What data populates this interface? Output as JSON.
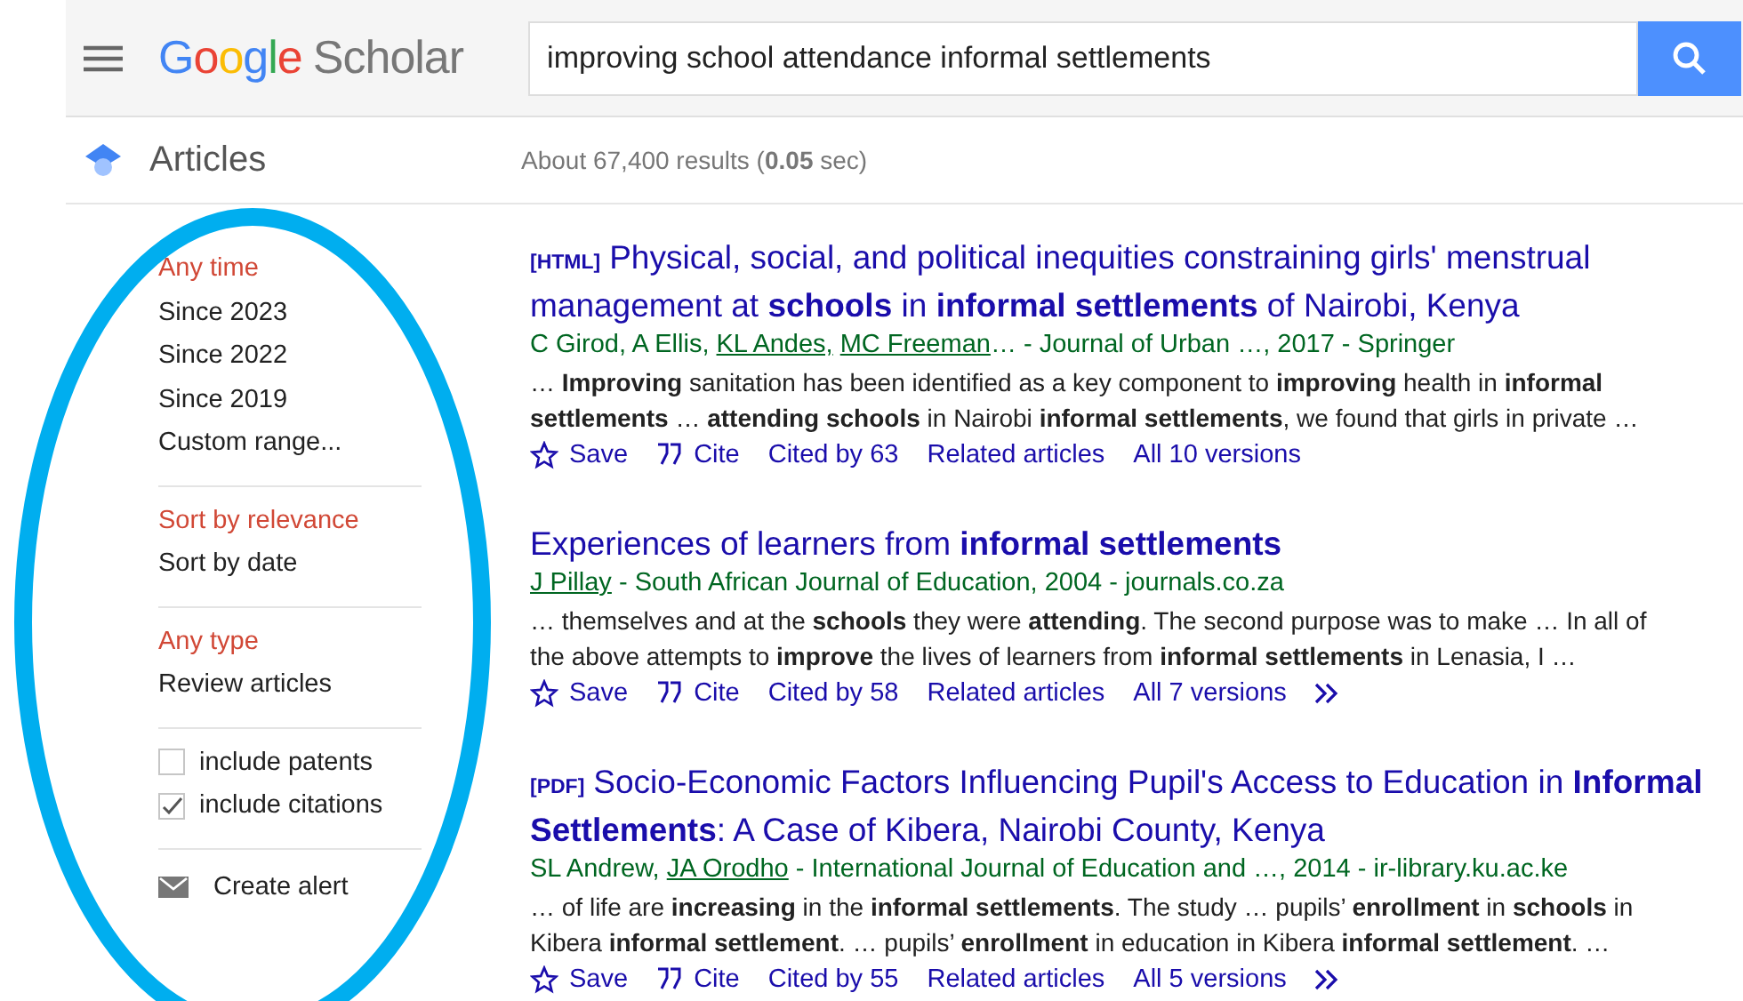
{
  "header": {
    "logo_brand": "Google",
    "logo_product": "Scholar",
    "search": {
      "value": "improving school attendance informal settlements"
    }
  },
  "subheader": {
    "section": "Articles",
    "stats": "About 67,400 results (**0.05** sec)"
  },
  "sidebar": {
    "groups": [
      {
        "kind": "links",
        "items": [
          {
            "label": "Any time",
            "selected": true
          },
          {
            "label": "Since 2023",
            "selected": false
          },
          {
            "label": "Since 2022",
            "selected": false
          },
          {
            "label": "Since 2019",
            "selected": false
          },
          {
            "label": "Custom range...",
            "selected": false
          }
        ]
      },
      {
        "kind": "links",
        "items": [
          {
            "label": "Sort by relevance",
            "selected": true
          },
          {
            "label": "Sort by date",
            "selected": false
          }
        ]
      },
      {
        "kind": "links",
        "items": [
          {
            "label": "Any type",
            "selected": true
          },
          {
            "label": "Review articles",
            "selected": false
          }
        ]
      },
      {
        "kind": "checks",
        "items": [
          {
            "label": "include patents",
            "checked": false
          },
          {
            "label": "include citations",
            "checked": true
          }
        ]
      },
      {
        "kind": "alert",
        "items": [
          {
            "label": "Create alert"
          }
        ]
      }
    ]
  },
  "results": [
    {
      "tag": "[HTML]",
      "title": "Physical, social, and political inequities constraining girls' menstrual management at **schools** in **informal settlements** of Nairobi, Kenya",
      "byline": [
        {
          "text": "C Girod, A Ellis, ",
          "link": false
        },
        {
          "text": "KL Andes,",
          "link": true
        },
        {
          "text": "MC Freeman",
          "link": true
        },
        {
          "text": "… - Journal of Urban …, 2017 - Springer",
          "link": false
        }
      ],
      "snippet": "… **Improving** sanitation has been identified as a key component to **improving** health in **informal settlements** … **attending schools** in Nairobi **informal settlements**, we found that girls in private …",
      "actions": {
        "save": "Save",
        "cite": "Cite",
        "cited_by": "Cited by 63",
        "related": "Related articles",
        "versions": "All 10 versions",
        "more": false
      }
    },
    {
      "title": "Experiences of learners from **informal settlements**",
      "byline": [
        {
          "text": "J Pillay",
          "link": true
        },
        {
          "text": " - South African Journal of Education, 2004 - journals.co.za",
          "link": false
        }
      ],
      "snippet": "… themselves and at the **schools** they were **attending**. The second purpose was to make … In all of the above attempts to **improve** the lives of learners from **informal settlements** in Lenasia, I …",
      "actions": {
        "save": "Save",
        "cite": "Cite",
        "cited_by": "Cited by 58",
        "related": "Related articles",
        "versions": "All 7 versions",
        "more": true
      }
    },
    {
      "tag": "[PDF]",
      "title": "Socio-Economic Factors Influencing Pupil's Access to Education in **Informal Settlements**: A Case of Kibera, Nairobi County, Kenya",
      "byline": [
        {
          "text": "SL Andrew, ",
          "link": false
        },
        {
          "text": "JA Orodho",
          "link": true
        },
        {
          "text": " - International Journal of Education and …, 2014 - ir-library.ku.ac.ke",
          "link": false
        }
      ],
      "snippet": "… of life are **increasing** in the **informal settlements**. The study … pupils’ **enrollment** in **schools** in Kibera **informal settlement**. … pupils’ **enrollment** in education in Kibera **informal settlement**. …",
      "actions": {
        "save": "Save",
        "cite": "Cite",
        "cited_by": "Cited by 55",
        "related": "Related articles",
        "versions": "All 5 versions",
        "more": true
      }
    }
  ],
  "annotation": {
    "kind": "ellipse"
  }
}
